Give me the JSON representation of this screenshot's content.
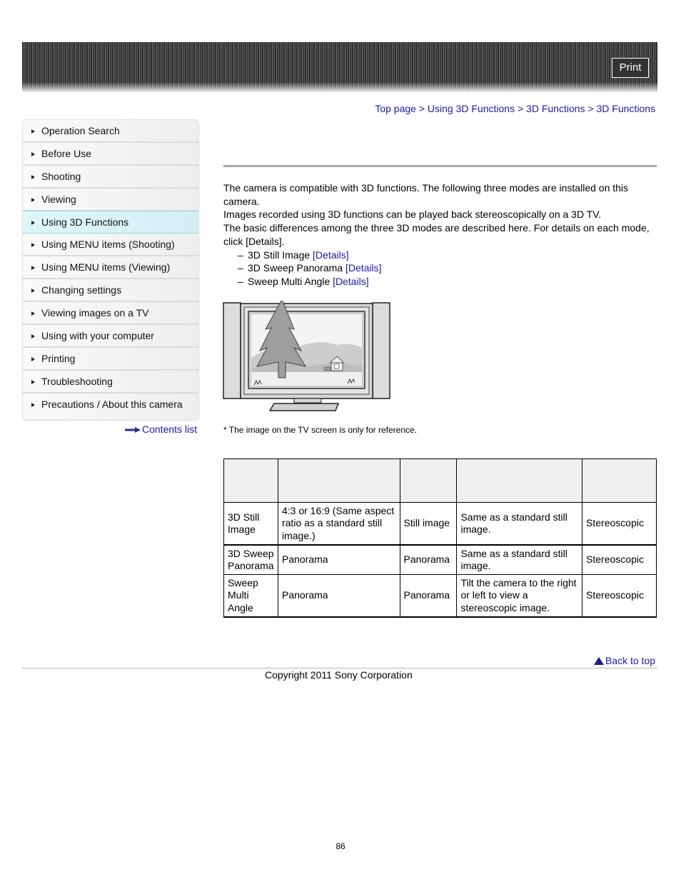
{
  "header": {
    "print_label": "Print"
  },
  "sidebar": {
    "items": [
      {
        "label": "Operation Search",
        "active": false
      },
      {
        "label": "Before Use",
        "active": false
      },
      {
        "label": "Shooting",
        "active": false
      },
      {
        "label": "Viewing",
        "active": false
      },
      {
        "label": "Using 3D Functions",
        "active": true
      },
      {
        "label": "Using MENU items (Shooting)",
        "active": false
      },
      {
        "label": "Using MENU items (Viewing)",
        "active": false
      },
      {
        "label": "Changing settings",
        "active": false
      },
      {
        "label": "Viewing images on a TV",
        "active": false
      },
      {
        "label": "Using with your computer",
        "active": false
      },
      {
        "label": "Printing",
        "active": false
      },
      {
        "label": "Troubleshooting",
        "active": false
      },
      {
        "label": "Precautions / About this camera",
        "active": false
      }
    ],
    "contents_link": "Contents list"
  },
  "breadcrumb": {
    "items": [
      "Top page",
      "Using 3D Functions",
      "3D Functions",
      "3D Functions"
    ],
    "separator": ">"
  },
  "intro": {
    "para1": "The camera is compatible with 3D functions. The following three modes are installed on this camera.",
    "para2": "Images recorded using 3D functions can be played back stereoscopically on a 3D TV.",
    "para3": "The basic differences among the three 3D modes are described here. For details on each mode, click [Details].",
    "modes": [
      {
        "name": "3D Still Image",
        "link": "[Details]"
      },
      {
        "name": "3D Sweep Panorama",
        "link": "[Details]"
      },
      {
        "name": "Sweep Multi Angle",
        "link": "[Details]"
      }
    ],
    "dash": "–"
  },
  "figure": {
    "alt": "tv-illustration",
    "caption": "* The image on the TV screen is only for reference."
  },
  "table": {
    "headers": [
      "",
      "",
      "",
      "",
      ""
    ],
    "rows": [
      [
        "3D Still Image",
        "4:3 or 16:9 (Same aspect ratio as a standard still image.)",
        "Still image",
        "Same as a standard still image.",
        "Stereoscopic"
      ],
      [
        "3D Sweep Panorama",
        "Panorama",
        "Panorama",
        "Same as a standard still image.",
        "Stereoscopic"
      ],
      [
        "Sweep Multi Angle",
        "Panorama",
        "Panorama",
        "Tilt the camera to the right or left to view a stereoscopic image.",
        "Stereoscopic"
      ]
    ]
  },
  "footer": {
    "back_to_top": "Back to top",
    "copyright": "Copyright 2011 Sony Corporation",
    "page_number": "86"
  }
}
